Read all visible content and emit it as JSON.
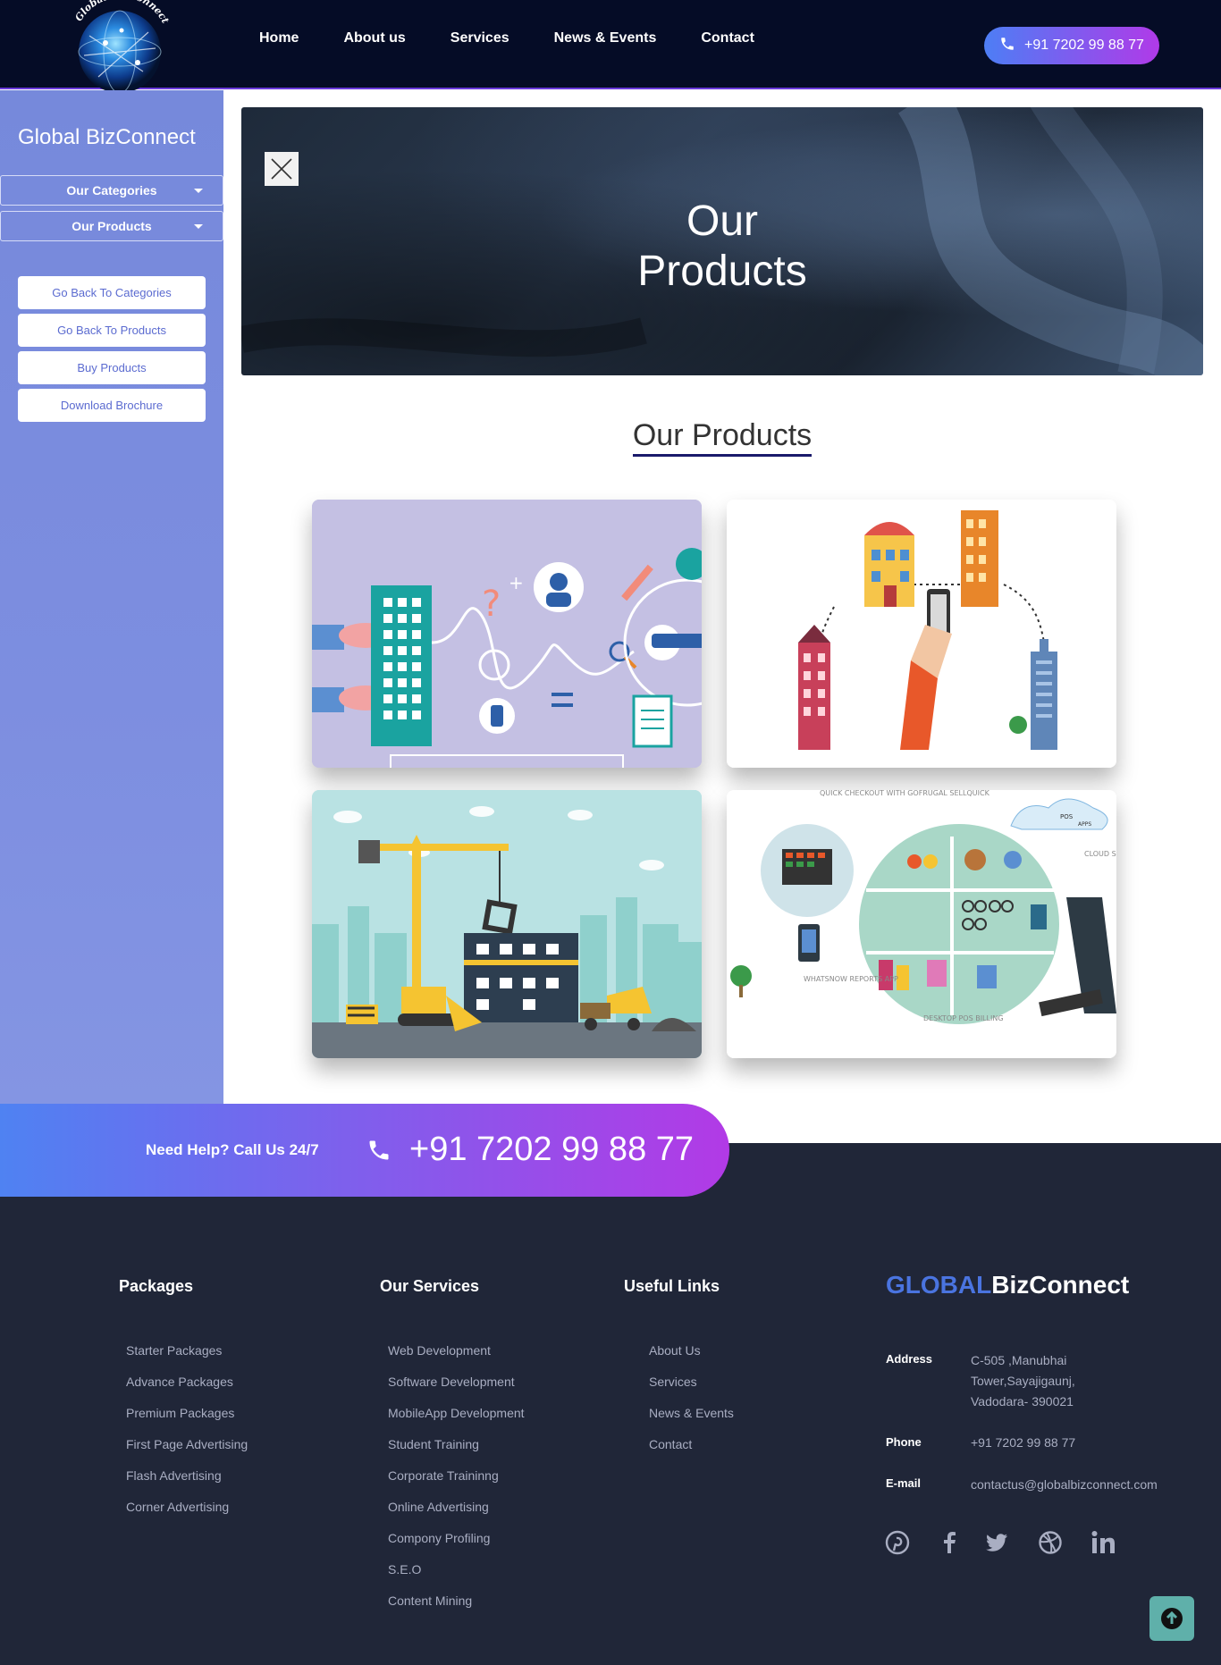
{
  "header": {
    "logo_text": "Global BizConnect",
    "nav": [
      "Home",
      "About us",
      "Services",
      "News & Events",
      "Contact"
    ],
    "phone": "+91 7202 99 88 77"
  },
  "sidebar": {
    "title": "Global BizConnect",
    "dropdowns": [
      "Our Categories",
      "Our Products"
    ],
    "buttons": [
      "Go Back To Categories",
      "Go Back To Products",
      "Buy Products",
      "Download Brochure"
    ]
  },
  "banner": {
    "title_line1": "Our",
    "title_line2": "Products"
  },
  "section_title": "Our Products",
  "products": [
    {
      "illustration": "healthcare-tech"
    },
    {
      "illustration": "hotel-booking-app"
    },
    {
      "illustration": "construction"
    },
    {
      "illustration": "retail-pos-system",
      "captions": [
        "QUICK CHECKOUT WITH GOFRUGAL SELLQUICK",
        "CLOUD SOLUTION",
        "WHATSNOW REPORTS APP",
        "DESKTOP POS BILLING",
        "POS",
        "APPS"
      ]
    }
  ],
  "cta": {
    "label": "Need Help? Call Us 24/7",
    "number": "+91 7202 99 88 77"
  },
  "footer": {
    "packages": {
      "title": "Packages",
      "items": [
        "Starter Packages",
        "Advance Packages",
        "Premium Packages",
        "First Page Advertising",
        "Flash Advertising",
        "Corner Advertising"
      ]
    },
    "services": {
      "title": "Our Services",
      "items": [
        "Web Development",
        "Software Development",
        "MobileApp Development",
        "Student Training",
        "Corporate Traininng",
        "Online Advertising",
        "Compony Profiling",
        "S.E.O",
        "Content Mining"
      ]
    },
    "links": {
      "title": "Useful Links",
      "items": [
        "About Us",
        "Services",
        "News & Events",
        "Contact"
      ]
    },
    "brand_part1": "GLOBAL",
    "brand_part2": "BizConnect",
    "address_label": "Address",
    "address_lines": [
      "C-505 ,Manubhai",
      "Tower,Sayajigaunj,",
      "Vadodara- 390021"
    ],
    "phone_label": "Phone",
    "phone": "+91 7202 99 88 77",
    "email_label": "E-mail",
    "email": "contactus@globalbizconnect.com",
    "social": [
      "pinterest-icon",
      "facebook-icon",
      "twitter-icon",
      "dribbble-icon",
      "linkedin-icon"
    ]
  },
  "colors": {
    "header_bg": "#050c26",
    "sidebar_bg": "#7a8bde",
    "cta_gradient_start": "#4f82f2",
    "cta_gradient_end": "#b23ae6",
    "footer_bg": "#202638",
    "brand_accent": "#4a74e0"
  }
}
